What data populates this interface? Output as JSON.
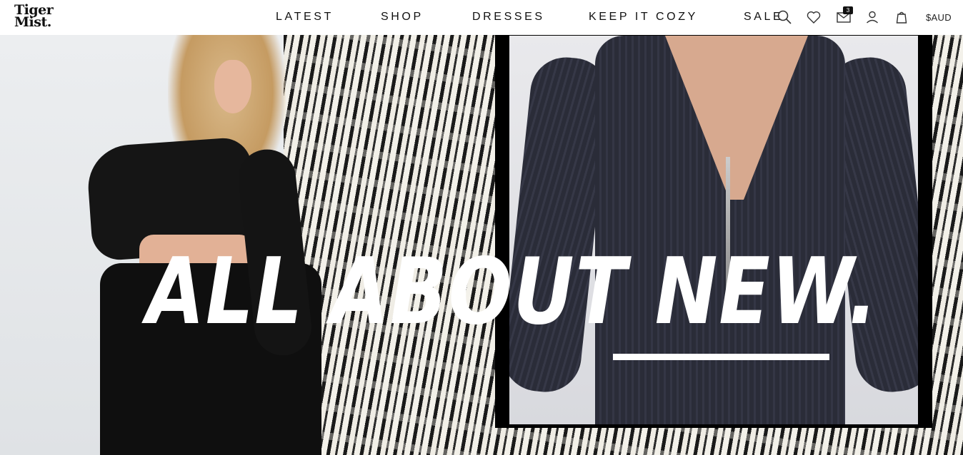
{
  "brand": {
    "logo_line1": "Tiger",
    "logo_line2": "Mist."
  },
  "nav": {
    "items": [
      {
        "label": "LATEST"
      },
      {
        "label": "SHOP"
      },
      {
        "label": "DRESSES"
      },
      {
        "label": "KEEP IT COZY"
      },
      {
        "label": "SALE"
      }
    ]
  },
  "header_icons": {
    "search": "search-icon",
    "wishlist": "heart-icon",
    "inbox": "mail-icon",
    "inbox_badge": "3",
    "account": "user-icon",
    "bag": "bag-icon",
    "currency": "$AUD"
  },
  "hero": {
    "headline_part1": "ALL ABOUT",
    "headline_part2": "NEW."
  },
  "colors": {
    "text": "#111111",
    "background": "#ffffff",
    "headline": "#ffffff"
  }
}
